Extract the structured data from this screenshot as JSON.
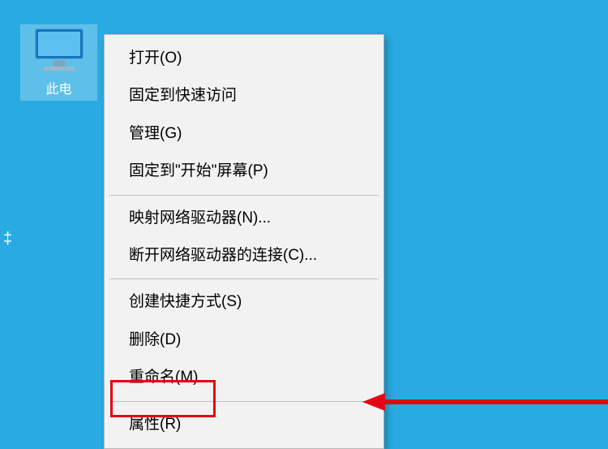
{
  "desktop": {
    "icon_label": "此电",
    "sidebar_char": "‡"
  },
  "context_menu": {
    "items": [
      {
        "label": "打开(O)"
      },
      {
        "label": "固定到快速访问"
      },
      {
        "label": "管理(G)"
      },
      {
        "label": "固定到\"开始\"屏幕(P)"
      }
    ],
    "group2": [
      {
        "label": "映射网络驱动器(N)..."
      },
      {
        "label": "断开网络驱动器的连接(C)..."
      }
    ],
    "group3": [
      {
        "label": "创建快捷方式(S)"
      },
      {
        "label": "删除(D)"
      },
      {
        "label": "重命名(M)"
      }
    ],
    "group4": [
      {
        "label": "属性(R)"
      }
    ]
  },
  "colors": {
    "desktop_bg": "#29abe2",
    "menu_bg": "#f2f2f2",
    "highlight": "#e30613"
  }
}
